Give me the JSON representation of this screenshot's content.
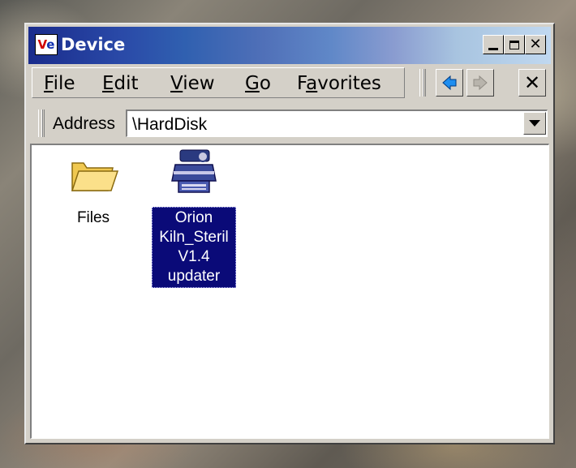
{
  "window": {
    "title": "Device",
    "app_icon_text_v": "V",
    "app_icon_text_e": "e",
    "caption_buttons": [
      "minimize-icon",
      "maximize-icon",
      "close-icon"
    ],
    "close_glyph": "✕"
  },
  "menubar": {
    "items": [
      {
        "label": "File",
        "accelerator": "F"
      },
      {
        "label": "Edit",
        "accelerator": "E"
      },
      {
        "label": "View",
        "accelerator": "V"
      },
      {
        "label": "Go",
        "accelerator": "G"
      },
      {
        "label": "Favorites",
        "accelerator": "a"
      }
    ]
  },
  "navigation": {
    "back_icon": "back-arrow-icon",
    "forward_icon": "forward-arrow-icon",
    "stop_glyph": "✕"
  },
  "address": {
    "label": "Address",
    "value": "\\HardDisk"
  },
  "files": [
    {
      "name_lines": [
        "Files"
      ],
      "icon": "folder-icon",
      "selected": false
    },
    {
      "name_lines": [
        "Orion",
        "Kiln_Steril",
        "V1.4",
        "updater"
      ],
      "icon": "installer-icon",
      "selected": true
    }
  ],
  "colors": {
    "title_gradient_start": "#1a2c8c",
    "title_gradient_end": "#c0d8f0",
    "selection": "#0a0a78",
    "chrome": "#d4d0c8"
  }
}
